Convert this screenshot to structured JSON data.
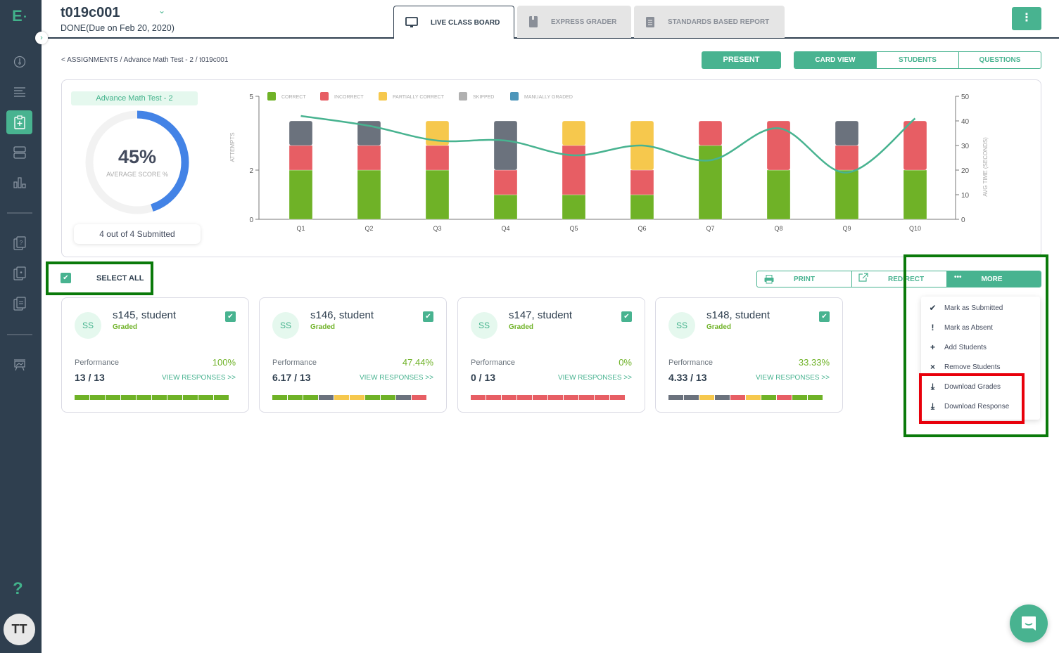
{
  "app": {
    "logo": "E",
    "help": "?",
    "user_initials": "TT"
  },
  "header": {
    "title": "t019c001",
    "status": "DONE(Due on Feb 20, 2020)",
    "tabs": [
      {
        "label": "LIVE CLASS BOARD",
        "icon": "monitor-icon",
        "active": true
      },
      {
        "label": "EXPRESS GRADER",
        "icon": "bookmark-icon",
        "active": false
      },
      {
        "label": "STANDARDS BASED REPORT",
        "icon": "clipboard-icon",
        "active": false
      }
    ],
    "menu_icon": "⋮"
  },
  "breadcrumb": "<  ASSIGNMENTS / Advance Math Test - 2 / t019c001",
  "toolbar": {
    "present_label": "PRESENT",
    "views": [
      {
        "label": "CARD VIEW",
        "active": true
      },
      {
        "label": "STUDENTS",
        "active": false
      },
      {
        "label": "QUESTIONS",
        "active": false
      }
    ]
  },
  "summary": {
    "test_name": "Advance Math Test - 2",
    "average_score": "45%",
    "average_score_fraction": 0.45,
    "average_label": "AVERAGE SCORE %",
    "submitted": "4 out of 4 Submitted"
  },
  "chart_data": {
    "type": "bar",
    "stacked": true,
    "categories": [
      "Q1",
      "Q2",
      "Q3",
      "Q4",
      "Q5",
      "Q6",
      "Q7",
      "Q8",
      "Q9",
      "Q10"
    ],
    "series": [
      {
        "name": "CORRECT",
        "color": "#6fb227",
        "values": [
          2,
          2,
          2,
          1,
          1,
          1,
          3,
          2,
          2,
          2
        ]
      },
      {
        "name": "INCORRECT",
        "color": "#e75e64",
        "values": [
          1,
          1,
          1,
          1,
          2,
          1,
          1,
          2,
          1,
          2
        ]
      },
      {
        "name": "PARTIALLY CORRECT",
        "color": "#f6c84d",
        "values": [
          0,
          0,
          1,
          0,
          1,
          2,
          0,
          0,
          0,
          0
        ]
      },
      {
        "name": "SKIPPED",
        "color": "#6b727d",
        "legend_color": "#b0b0b0",
        "values": [
          1,
          1,
          0,
          2,
          0,
          0,
          0,
          0,
          1,
          0
        ]
      },
      {
        "name": "MANUALLY GRADED",
        "color": "#4d96ba",
        "values": [
          0,
          0,
          0,
          0,
          0,
          0,
          0,
          0,
          0,
          0
        ]
      }
    ],
    "line_series": {
      "name": "AVG TIME (SECONDS)",
      "color": "#48b390",
      "values": [
        42,
        38,
        32,
        32,
        26,
        30,
        24,
        37,
        19,
        41
      ]
    },
    "ylabel": "ATTEMPTS",
    "ylim": [
      0,
      5
    ],
    "yticks": [
      0,
      2,
      5
    ],
    "y2label": "AVG TIME (SECONDS)",
    "y2lim": [
      0,
      50
    ],
    "y2ticks": [
      0,
      10,
      20,
      30,
      40,
      50
    ],
    "legend": "top-left",
    "grid": false
  },
  "select_all": {
    "label": "SELECT ALL",
    "checked": true
  },
  "actions": {
    "print": "PRINT",
    "redirect": "REDIRECT",
    "more": "MORE",
    "more_icon": "•••"
  },
  "more_menu": [
    {
      "label": "Mark as Submitted",
      "icon": "check-icon",
      "glyph": "✔"
    },
    {
      "label": "Mark as Absent",
      "icon": "exclamation-icon",
      "glyph": "!"
    },
    {
      "label": "Add Students",
      "icon": "plus-icon",
      "glyph": "+"
    },
    {
      "label": "Remove Students",
      "icon": "times-icon",
      "glyph": "×"
    },
    {
      "label": "Download Grades",
      "icon": "download-icon",
      "glyph": "⤓"
    },
    {
      "label": "Download Response",
      "icon": "download-icon",
      "glyph": "⤓"
    }
  ],
  "students": [
    {
      "initials": "SS",
      "name": "s145, student",
      "status": "Graded",
      "performance_label": "Performance",
      "percent": "100%",
      "score": "13 / 13",
      "view_label": "VIEW RESPONSES >>",
      "checked": true,
      "responses": [
        "correct",
        "correct",
        "correct",
        "correct",
        "correct",
        "correct",
        "correct",
        "correct",
        "correct",
        "correct"
      ]
    },
    {
      "initials": "SS",
      "name": "s146, student",
      "status": "Graded",
      "performance_label": "Performance",
      "percent": "47.44%",
      "score": "6.17 / 13",
      "view_label": "VIEW RESPONSES >>",
      "checked": true,
      "responses": [
        "correct",
        "correct",
        "correct",
        "skipped",
        "partial",
        "partial",
        "correct",
        "correct",
        "skipped",
        "incorrect"
      ]
    },
    {
      "initials": "SS",
      "name": "s147, student",
      "status": "Graded",
      "performance_label": "Performance",
      "percent": "0%",
      "score": "0 / 13",
      "view_label": "VIEW RESPONSES >>",
      "checked": true,
      "responses": [
        "incorrect",
        "incorrect",
        "incorrect",
        "incorrect",
        "incorrect",
        "incorrect",
        "incorrect",
        "incorrect",
        "incorrect",
        "incorrect"
      ]
    },
    {
      "initials": "SS",
      "name": "s148, student",
      "status": "Graded",
      "performance_label": "Performance",
      "percent": "33.33%",
      "score": "4.33 / 13",
      "view_label": "VIEW RESPONSES >>",
      "checked": true,
      "responses": [
        "skipped",
        "skipped",
        "partial",
        "skipped",
        "incorrect",
        "partial",
        "correct",
        "incorrect",
        "correct",
        "correct"
      ]
    }
  ],
  "colors": {
    "accent": "#48b390",
    "sidebar": "#2f3f4f",
    "correct": "#6fb227",
    "incorrect": "#e75e64",
    "partial": "#f6c84d",
    "skipped": "#6b727d",
    "donut": "#4383e6"
  }
}
